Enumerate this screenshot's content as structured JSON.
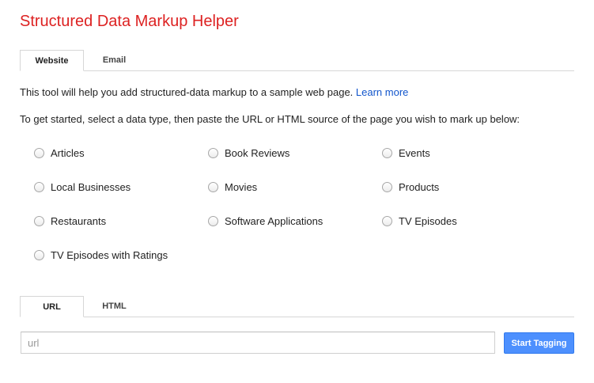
{
  "page": {
    "title": "Structured Data Markup Helper"
  },
  "source_tabs": [
    {
      "label": "Website",
      "active": true
    },
    {
      "label": "Email",
      "active": false
    }
  ],
  "intro": {
    "text": "This tool will help you add structured-data markup to a sample web page.",
    "link_label": "Learn more"
  },
  "instructions": "To get started, select a data type, then paste the URL or HTML source of the page you wish to mark up below:",
  "data_types": [
    {
      "label": "Articles",
      "selected": false
    },
    {
      "label": "Book Reviews",
      "selected": false
    },
    {
      "label": "Events",
      "selected": false
    },
    {
      "label": "Local Businesses",
      "selected": false
    },
    {
      "label": "Movies",
      "selected": false
    },
    {
      "label": "Products",
      "selected": false
    },
    {
      "label": "Restaurants",
      "selected": false
    },
    {
      "label": "Software Applications",
      "selected": false
    },
    {
      "label": "TV Episodes",
      "selected": false
    },
    {
      "label": "TV Episodes with Ratings",
      "selected": false
    }
  ],
  "input_tabs": [
    {
      "label": "URL",
      "active": true
    },
    {
      "label": "HTML",
      "active": false
    }
  ],
  "url_field": {
    "value": "",
    "placeholder": "url"
  },
  "start_button_label": "Start Tagging",
  "colors": {
    "title": "#dd2222",
    "link": "#1155cc",
    "button": "#4d90fe"
  }
}
